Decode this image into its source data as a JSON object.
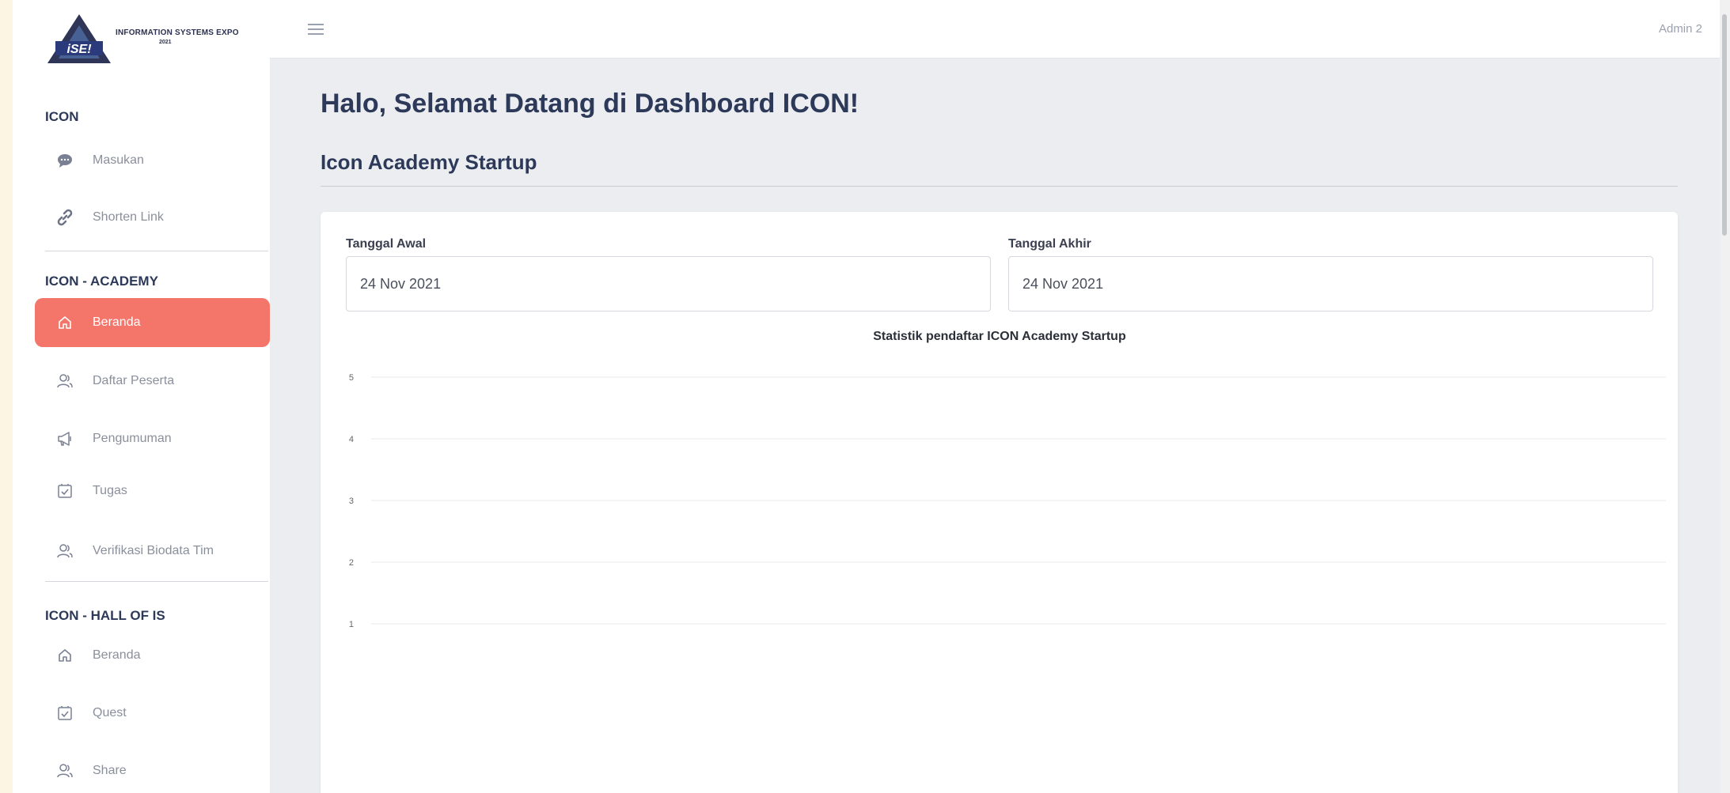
{
  "logo": {
    "line1": "INFORMATION SYSTEMS EXPO",
    "line2": "2021"
  },
  "topbar": {
    "user": "Admin 2"
  },
  "sidebar": {
    "sections": [
      {
        "title": "ICON",
        "items": [
          {
            "label": "Masukan",
            "icon": "chat-icon"
          },
          {
            "label": "Shorten Link",
            "icon": "link-icon"
          }
        ]
      },
      {
        "title": "ICON - ACADEMY",
        "items": [
          {
            "label": "Beranda",
            "icon": "home-icon",
            "active": true
          },
          {
            "label": "Daftar Peserta",
            "icon": "users-icon"
          },
          {
            "label": "Pengumuman",
            "icon": "megaphone-icon"
          },
          {
            "label": "Tugas",
            "icon": "checklist-icon"
          },
          {
            "label": "Verifikasi Biodata Tim",
            "icon": "users-icon"
          }
        ]
      },
      {
        "title": "ICON - HALL OF IS",
        "items": [
          {
            "label": "Beranda",
            "icon": "home-icon"
          },
          {
            "label": "Quest",
            "icon": "checklist-icon"
          },
          {
            "label": "Share",
            "icon": "users-icon"
          }
        ]
      }
    ]
  },
  "main": {
    "title": "Halo, Selamat Datang di Dashboard ICON!",
    "subtitle": "Icon Academy Startup",
    "start_label": "Tanggal Awal",
    "start_value": "24 Nov 2021",
    "end_label": "Tanggal Akhir",
    "end_value": "24 Nov 2021"
  },
  "colors": {
    "accent": "#f4756a",
    "heading": "#2d3958"
  },
  "chart_data": {
    "type": "line",
    "title": "Statistik pendaftar ICON Academy Startup",
    "xlabel": "",
    "ylabel": "",
    "y_ticks": [
      "5",
      "4",
      "3",
      "2",
      "1"
    ],
    "ylim": [
      0,
      5
    ],
    "grid": true,
    "series": []
  }
}
